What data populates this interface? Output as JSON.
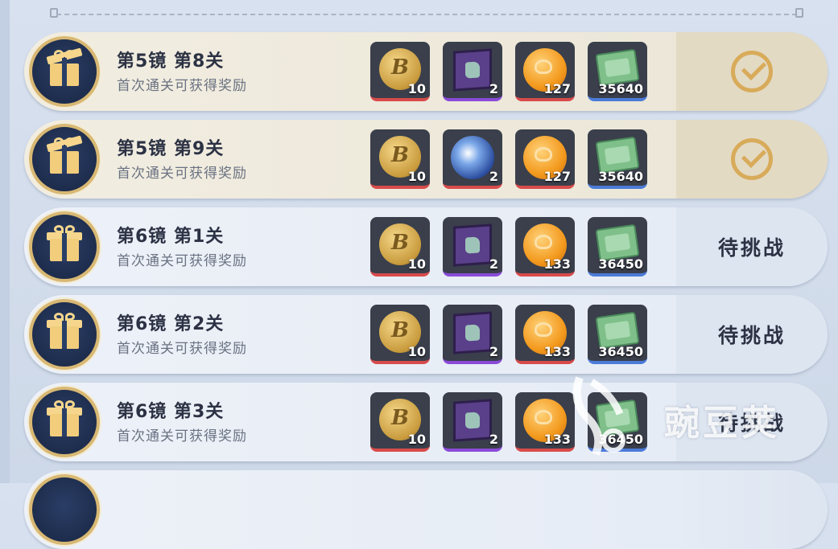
{
  "rows": [
    {
      "title": "第5镜  第8关",
      "subtitle": "首次通关可获得奖励",
      "state": "claimed",
      "status_text": "",
      "rewards": [
        {
          "icon": "b-coin-icon",
          "qty": "10"
        },
        {
          "icon": "crate-icon",
          "qty": "2"
        },
        {
          "icon": "orange-coin-icon",
          "qty": "127"
        },
        {
          "icon": "cash-icon",
          "qty": "35640"
        }
      ]
    },
    {
      "title": "第5镜  第9关",
      "subtitle": "首次通关可获得奖励",
      "state": "claimed",
      "status_text": "",
      "rewards": [
        {
          "icon": "b-coin-icon",
          "qty": "10"
        },
        {
          "icon": "orb-icon",
          "qty": "2"
        },
        {
          "icon": "orange-coin-icon",
          "qty": "127"
        },
        {
          "icon": "cash-icon",
          "qty": "35640"
        }
      ]
    },
    {
      "title": "第6镜  第1关",
      "subtitle": "首次通关可获得奖励",
      "state": "pending",
      "status_text": "待挑战",
      "rewards": [
        {
          "icon": "b-coin-icon",
          "qty": "10"
        },
        {
          "icon": "crate-icon",
          "qty": "2"
        },
        {
          "icon": "orange-coin-icon",
          "qty": "133"
        },
        {
          "icon": "cash-icon",
          "qty": "36450"
        }
      ]
    },
    {
      "title": "第6镜  第2关",
      "subtitle": "首次通关可获得奖励",
      "state": "pending",
      "status_text": "待挑战",
      "rewards": [
        {
          "icon": "b-coin-icon",
          "qty": "10"
        },
        {
          "icon": "crate-icon",
          "qty": "2"
        },
        {
          "icon": "orange-coin-icon",
          "qty": "133"
        },
        {
          "icon": "cash-icon",
          "qty": "36450"
        }
      ]
    },
    {
      "title": "第6镜  第3关",
      "subtitle": "首次通关可获得奖励",
      "state": "pending",
      "status_text": "待挑战",
      "rewards": [
        {
          "icon": "b-coin-icon",
          "qty": "10"
        },
        {
          "icon": "crate-icon",
          "qty": "2"
        },
        {
          "icon": "orange-coin-icon",
          "qty": "133"
        },
        {
          "icon": "cash-icon",
          "qty": "36450"
        }
      ]
    }
  ],
  "coin_letter": "B",
  "watermark": "豌豆荚"
}
